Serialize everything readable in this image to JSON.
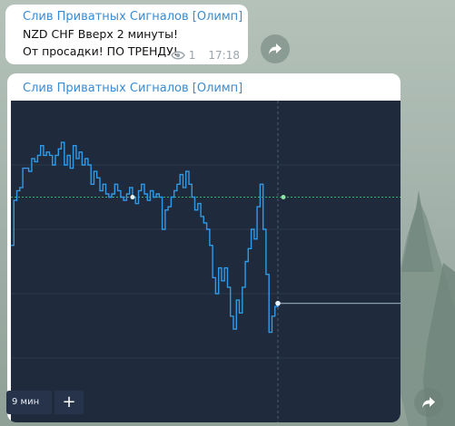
{
  "messages": [
    {
      "sender": "Слив Приватных Сигналов [Олимп]",
      "lines": [
        "NZD CHF Вверх 2 минуты!",
        "От просадки! ПО ТРЕНДУ!"
      ],
      "views": "1",
      "time": "17:18"
    },
    {
      "sender": "Слив Приватных Сигналов [Олимп]"
    }
  ],
  "chart_widget": {
    "timeframe_label": "9 мин",
    "add_label": "+",
    "colors": {
      "background": "#1f2b3c",
      "price_line": "#2f9be8",
      "entry_line": "#3fae6d",
      "current_line": "#8a9bb0"
    }
  },
  "chart_data": {
    "type": "line",
    "title": "",
    "xlabel": "",
    "ylabel": "",
    "series": [
      {
        "values": [
          0.55,
          0.69,
          0.72,
          0.73,
          0.79,
          0.79,
          0.78,
          0.82,
          0.81,
          0.83,
          0.86,
          0.83,
          0.84,
          0.83,
          0.8,
          0.83,
          0.85,
          0.87,
          0.8,
          0.83,
          0.79,
          0.86,
          0.82,
          0.84,
          0.8,
          0.82,
          0.8,
          0.74,
          0.78,
          0.76,
          0.72,
          0.74,
          0.71,
          0.7,
          0.71,
          0.74,
          0.72,
          0.7,
          0.69,
          0.71,
          0.73,
          0.7,
          0.68,
          0.72,
          0.74,
          0.71,
          0.69,
          0.72,
          0.7,
          0.71,
          0.7,
          0.6,
          0.66,
          0.67,
          0.7,
          0.72,
          0.74,
          0.77,
          0.73,
          0.78,
          0.74,
          0.7,
          0.66,
          0.68,
          0.64,
          0.62,
          0.6,
          0.55,
          0.45,
          0.4,
          0.48,
          0.44,
          0.48,
          0.42,
          0.33,
          0.29,
          0.38,
          0.34,
          0.42,
          0.5,
          0.54,
          0.6,
          0.57,
          0.67,
          0.74,
          0.6,
          0.46,
          0.28,
          0.33,
          0.36,
          0.37
        ]
      }
    ],
    "entry_level": 0.7,
    "current_level": 0.37,
    "ylim": [
      0,
      1
    ],
    "grid": false
  }
}
